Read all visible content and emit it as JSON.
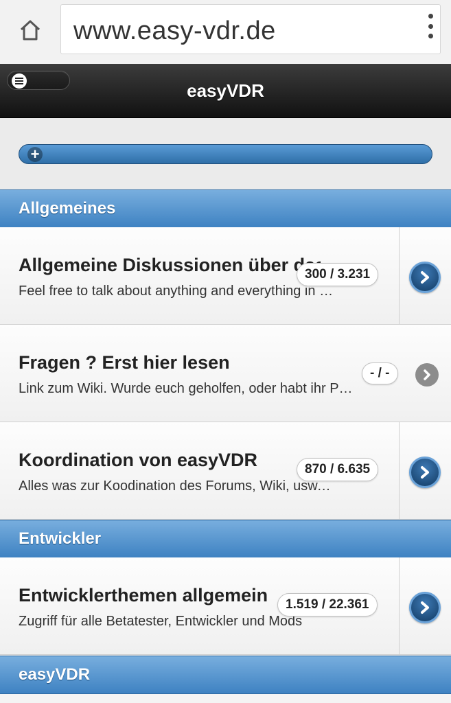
{
  "browser": {
    "url": "www.easy-vdr.de",
    "home_icon": "home-icon",
    "menu_icon": "more-vert-icon"
  },
  "header": {
    "title": "easyVDR",
    "menu_icon": "hamburger-icon"
  },
  "toolbar": {
    "add_icon": "plus-icon"
  },
  "sections": [
    {
      "title": "Allgemeines",
      "forums": [
        {
          "title": "Allgemeine Diskussionen über das",
          "description": "Feel free to talk about anything and everything in English",
          "count": "300 / 3.231"
        },
        {
          "title": "Fragen ? Erst hier lesen",
          "description": "Link zum Wiki. Wurde euch geholfen, oder habt ihr Probleme",
          "count": "- / -"
        },
        {
          "title": "Koordination von easyVDR",
          "description": "Alles was zur Koodination des Forums, Wiki, usw. gehört",
          "count": "870 / 6.635"
        }
      ]
    },
    {
      "title": "Entwickler",
      "forums": [
        {
          "title": "Entwicklerthemen allgemein",
          "description": "Zugriff für alle Betatester, Entwickler und Mods",
          "count": "1.519 / 22.361"
        }
      ]
    },
    {
      "title": "easyVDR",
      "forums": []
    }
  ],
  "colors": {
    "section_header": "#4a8fcd",
    "header_bg": "#1a1a1a",
    "arrow": "#1f4f80"
  }
}
